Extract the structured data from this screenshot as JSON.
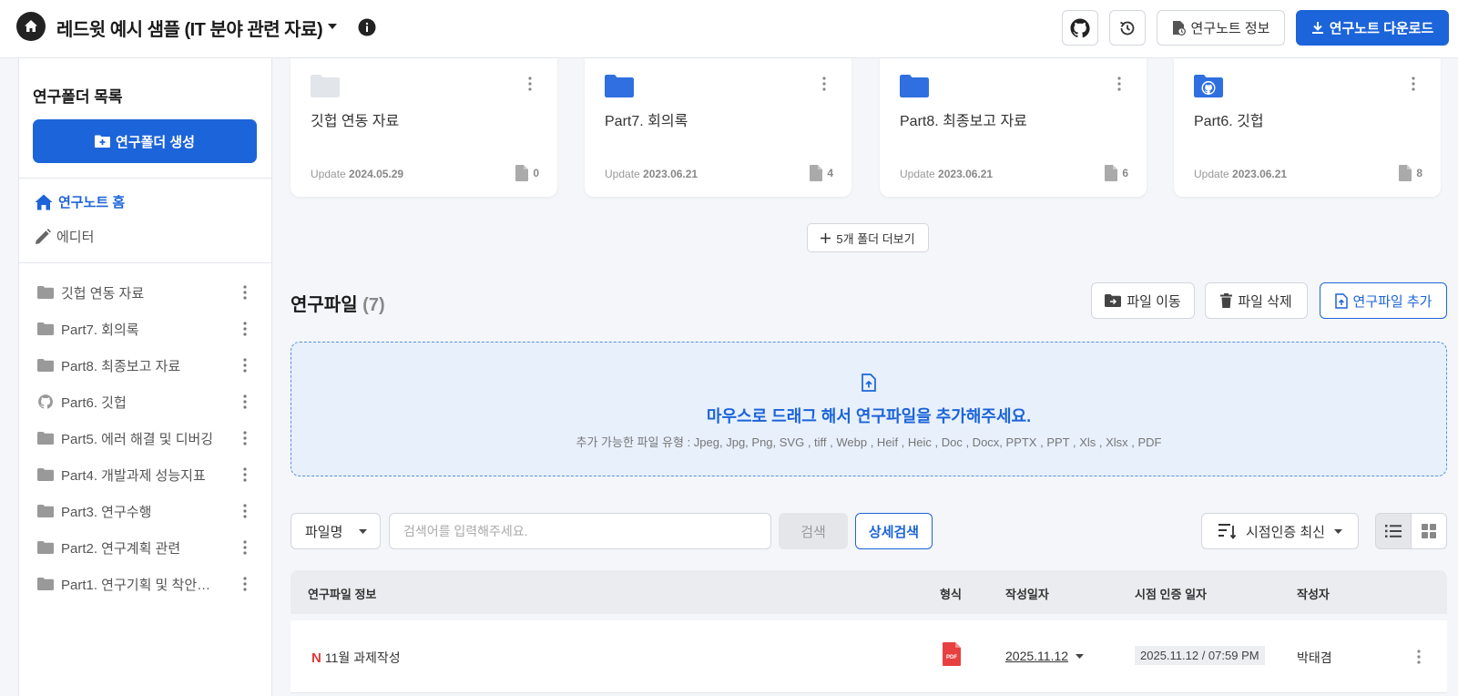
{
  "header": {
    "title": "레드윗 예시 샘플 (IT 분야 관련 자료)",
    "btn_info": "연구노트 정보",
    "btn_download": "연구노트 다운로드"
  },
  "sidebar": {
    "title": "연구폴더 목록",
    "create_label": "연구폴더 생성",
    "nav_home": "연구노트 홈",
    "nav_editor": "에디터",
    "folders": [
      {
        "label": "깃헙 연동 자료",
        "icon": "folder-icon"
      },
      {
        "label": "Part7. 회의록",
        "icon": "folder-icon"
      },
      {
        "label": "Part8. 최종보고 자료",
        "icon": "folder-icon"
      },
      {
        "label": "Part6. 깃헙",
        "icon": "github-icon"
      },
      {
        "label": "Part5. 에러 해결 및 디버깅",
        "icon": "folder-icon"
      },
      {
        "label": "Part4. 개발과제 성능지표",
        "icon": "folder-icon"
      },
      {
        "label": "Part3. 연구수행",
        "icon": "folder-icon"
      },
      {
        "label": "Part2. 연구계획 관련",
        "icon": "folder-icon"
      },
      {
        "label": "Part1. 연구기획 및 착안…",
        "icon": "folder-icon"
      }
    ]
  },
  "cards": [
    {
      "name": "깃헙 연동 자료",
      "update_label": "Update",
      "date": "2024.05.29",
      "count": "0",
      "folder_color": "#e2e5ea"
    },
    {
      "name": "Part7. 회의록",
      "update_label": "Update",
      "date": "2023.06.21",
      "count": "4",
      "folder_color": "#2f6fe0"
    },
    {
      "name": "Part8. 최종보고 자료",
      "update_label": "Update",
      "date": "2023.06.21",
      "count": "6",
      "folder_color": "#2f6fe0"
    },
    {
      "name": "Part6. 깃헙",
      "update_label": "Update",
      "date": "2023.06.21",
      "count": "8",
      "folder_color": "#2f6fe0"
    }
  ],
  "more_folders": "5개 폴더 더보기",
  "files": {
    "title": "연구파일",
    "count": "(7)",
    "btn_move": "파일 이동",
    "btn_delete": "파일 삭제",
    "btn_add": "연구파일 추가"
  },
  "dropzone": {
    "main": "마우스로 드래그 해서 연구파일을 추가해주세요.",
    "sub": "추가 가능한 파일 유형 : Jpeg, Jpg, Png, SVG , tiff , Webp , Heif , Heic , Doc , Docx, PPTX , PPT , Xls , Xlsx , PDF"
  },
  "search": {
    "select_value": "파일명",
    "placeholder": "검색어를 입력해주세요.",
    "search_label": "검색",
    "detail_label": "상세검색",
    "sort_label": "시점인증 최신"
  },
  "table": {
    "headers": [
      "연구파일 정보",
      "형식",
      "작성일자",
      "시점 인증 일자",
      "작성자"
    ],
    "rows": [
      {
        "badge": "N",
        "name": "11월 과제작성",
        "format": "PDF",
        "date": "2025.11.12",
        "cert_date": "2025.11.12 / 07:59 PM",
        "author": "박태겸"
      }
    ]
  },
  "colors": {
    "primary": "#1c64d9",
    "badge_new": "#e03a3a",
    "pdf": "#e84040"
  }
}
